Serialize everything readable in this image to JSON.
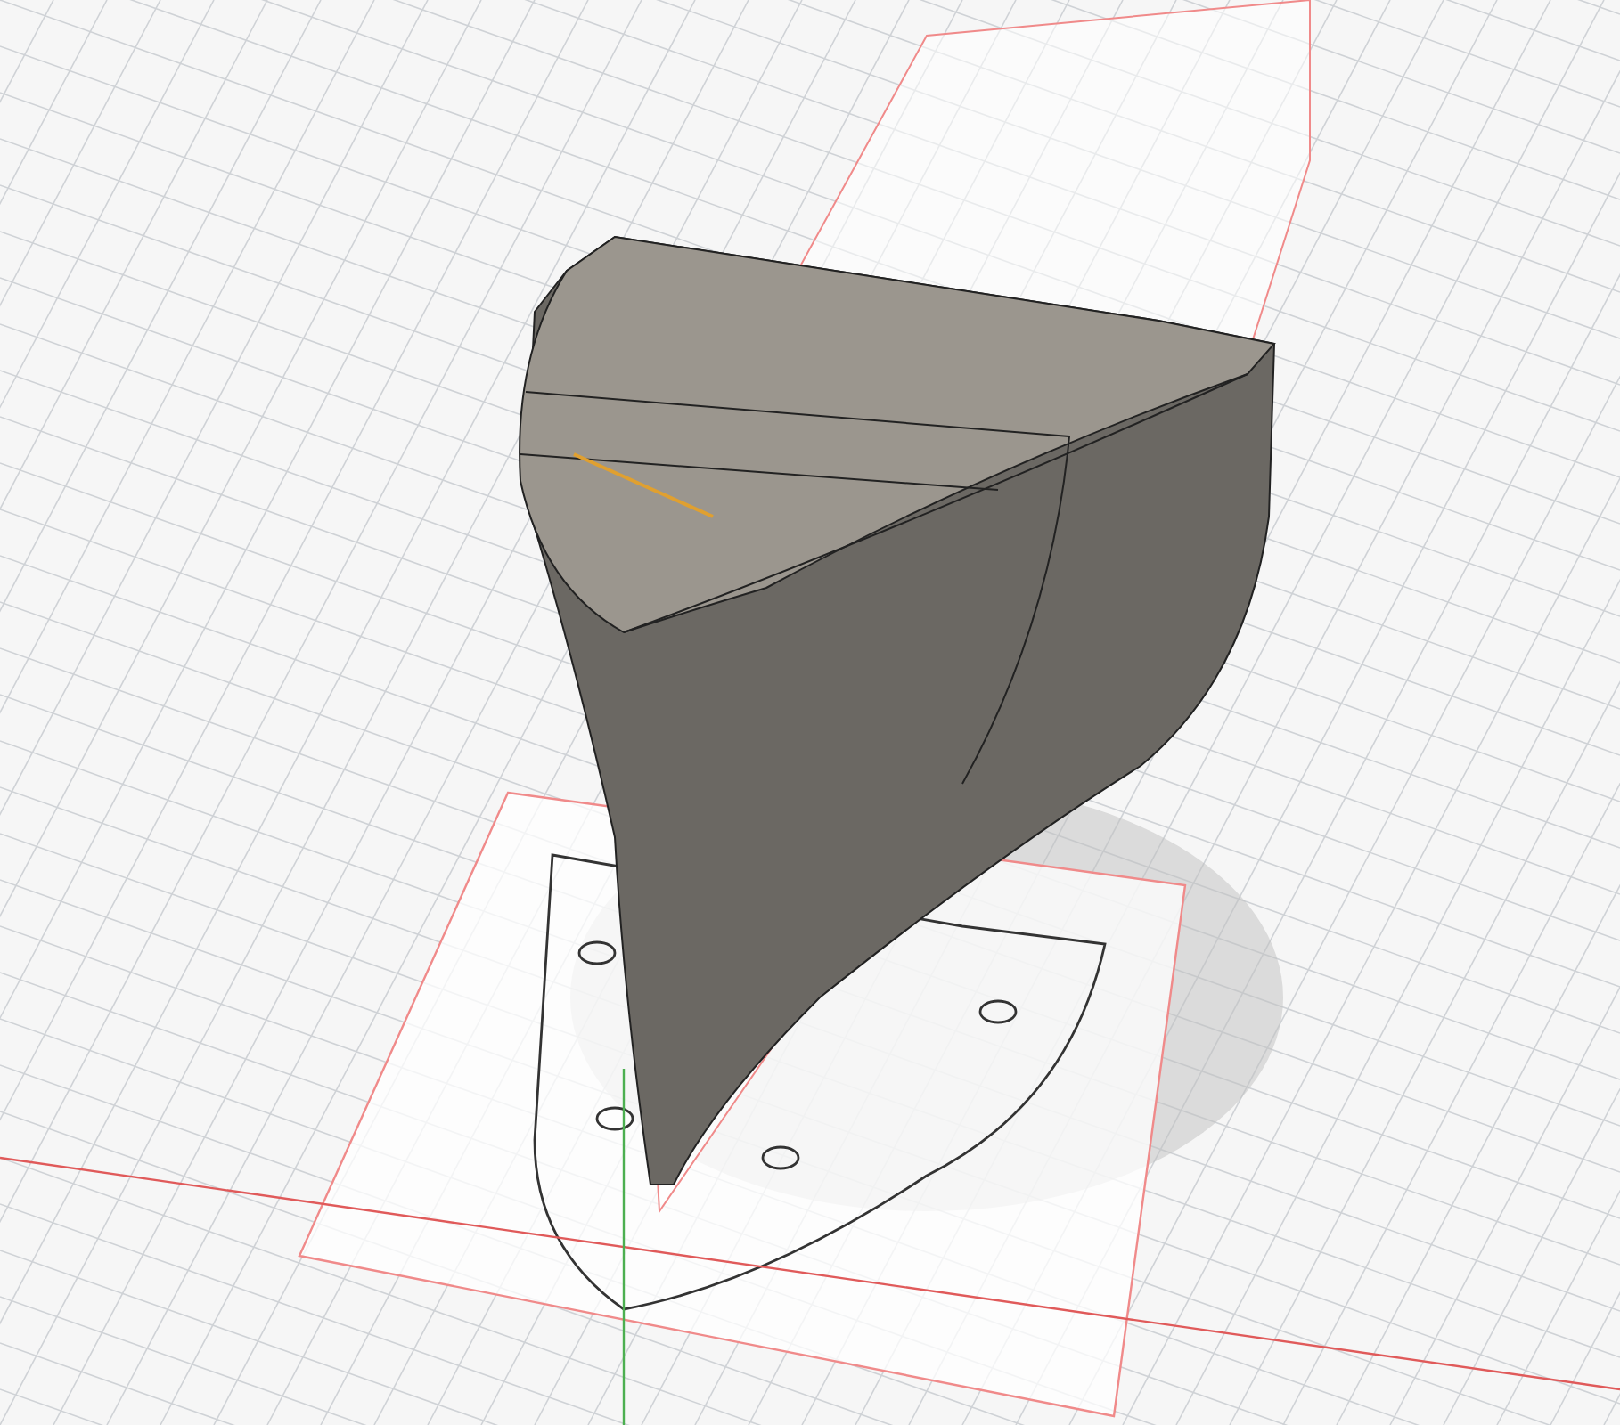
{
  "viewport": {
    "grid_visible": true,
    "axes_visible": true,
    "sketch_planes_visible": true
  }
}
